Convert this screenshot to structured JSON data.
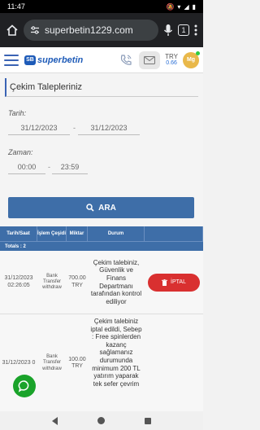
{
  "status_bar": {
    "time": "11:47"
  },
  "browser": {
    "url": "superbetin1229.com",
    "tab_count": "1"
  },
  "header": {
    "logo_badge": "SB",
    "brand": "superbetin",
    "currency": "TRY",
    "balance": "0.66",
    "avatar_initials": "Mg"
  },
  "page": {
    "title": "Çekim Talepleriniz"
  },
  "filters": {
    "date_label": "Tarih:",
    "date_from": "31/12/2023",
    "date_to": "31/12/2023",
    "time_label": "Zaman:",
    "time_from": "00:00",
    "time_to": "23:59",
    "separator": "-",
    "search_label": "ARA"
  },
  "table": {
    "headers": [
      "Tarih/Saat",
      "İşlem Çeşidi",
      "Miktar",
      "Durum",
      ""
    ],
    "totals": "Totals : 2",
    "rows": [
      {
        "date": "31/12/2023 02:26:05",
        "type": "Bank Transfer withdraw",
        "amount": "700.00 TRY",
        "status": "Çekim talebiniz, Güvenlik ve Finans Departmanı tarafından kontrol ediliyor",
        "action": "İPTAL"
      },
      {
        "date": "31/12/2023 0",
        "type": "Bank Transfer withdraw",
        "amount": "100.00 TRY",
        "status": "Çekim talebiniz iptal edildi, Sebep : Free spinlerden kazanç sağlamanız durumunda minimum 200 TL yatırım yaparak tek sefer çevrim",
        "action": ""
      }
    ]
  }
}
